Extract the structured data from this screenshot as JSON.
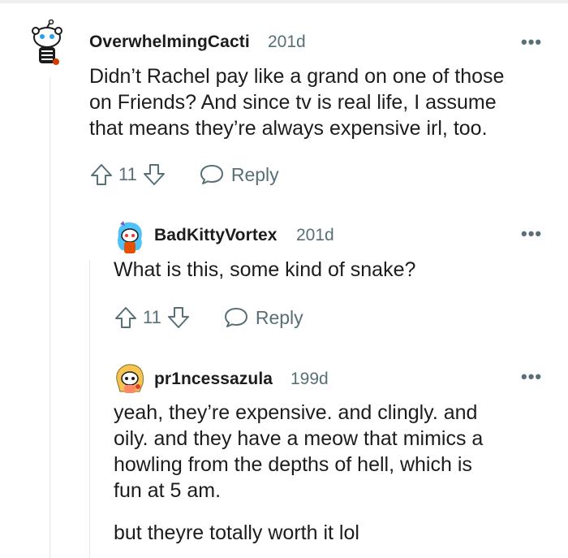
{
  "comments": [
    {
      "username": "OverwhelmingCacti",
      "age": "201d",
      "menu": "•••",
      "body": [
        "Didn’t Rachel pay like a grand on one of those",
        "on Friends? And since tv is real life, I assume",
        "that means they’re always expensive irl, too."
      ],
      "votes": "11",
      "reply_label": "Reply",
      "avatar_icon": "snoo-skeleton-avatar"
    },
    {
      "username": "BadKittyVortex",
      "age": "201d",
      "menu": "•••",
      "body": [
        "What is this, some kind of snake?"
      ],
      "votes": "11",
      "reply_label": "Reply",
      "avatar_icon": "snoo-blue-hair-avatar"
    },
    {
      "username": "pr1ncessazula",
      "age": "199d",
      "menu": "•••",
      "body": [
        "yeah, they’re expensive. and clingly. and",
        "oily. and they have a meow that mimics a",
        "howling from the depths of hell, which is",
        "fun at 5 am."
      ],
      "body2": "but theyre totally worth it lol",
      "avatar_icon": "snoo-blonde-avatar"
    }
  ],
  "colors": {
    "meta": "#576f76",
    "text": "#1c1c1c",
    "threadline": "#e3e5e8"
  }
}
